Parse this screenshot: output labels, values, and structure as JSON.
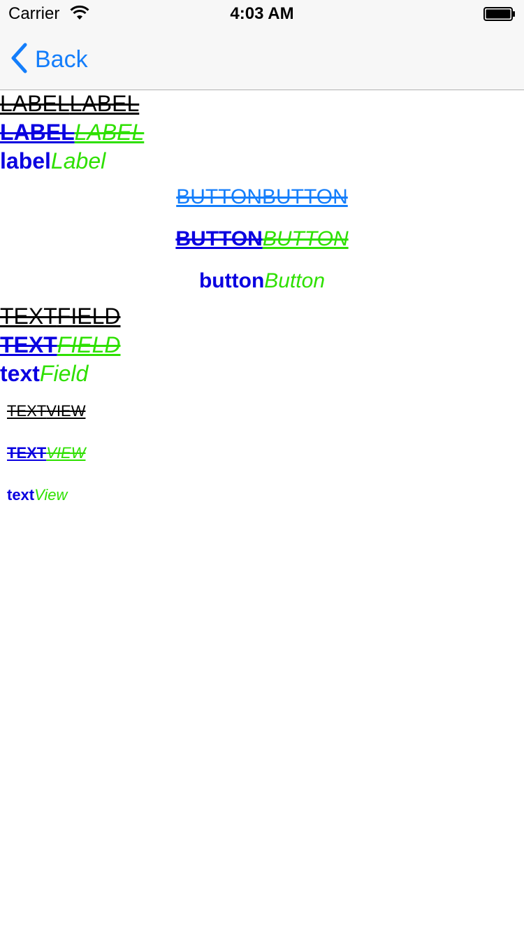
{
  "status_bar": {
    "carrier": "Carrier",
    "time": "4:03 AM",
    "wifi_icon": "wifi-icon",
    "battery_icon": "battery-icon"
  },
  "nav": {
    "back_label": "Back",
    "back_icon": "chevron-left-icon"
  },
  "label": {
    "line1": [
      "LABEL",
      "LABEL"
    ],
    "line2": [
      "LABEL",
      "LABEL"
    ],
    "line3": [
      "label",
      "Label"
    ]
  },
  "button": {
    "line1": [
      "BUTTON",
      "BUTTON"
    ],
    "line2": [
      "BUTTON",
      "BUTTON"
    ],
    "line3": [
      "button",
      "Button"
    ]
  },
  "textfield": {
    "line1": [
      "TEXT",
      "FIELD"
    ],
    "line2": [
      "TEXT",
      "FIELD"
    ],
    "line3": [
      "text",
      "Field"
    ]
  },
  "textview": {
    "line1": [
      "TEXT",
      "VIEW"
    ],
    "line2": [
      "TEXT",
      "VIEW"
    ],
    "line3": [
      "text",
      "View"
    ]
  },
  "colors": {
    "blue": "#0a00e0",
    "green": "#2ee000",
    "tint": "#147efb"
  }
}
